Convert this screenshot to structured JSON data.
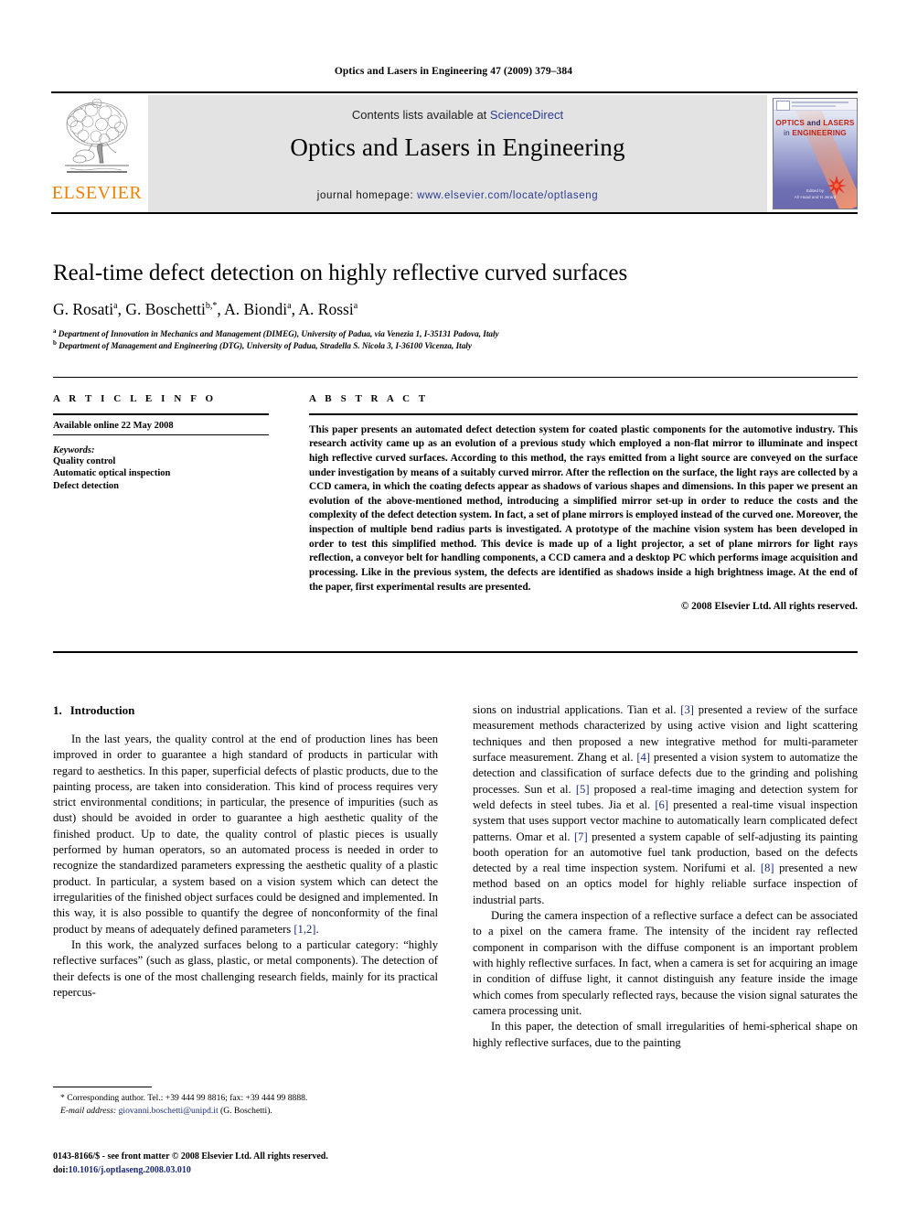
{
  "running_head": "Optics and Lasers in Engineering 47 (2009) 379–384",
  "masthead": {
    "publisher_name": "ELSEVIER",
    "contents_prefix": "Contents lists available at ",
    "contents_link": "ScienceDirect",
    "journal_name": "Optics and Lasers in Engineering",
    "homepage_prefix": "journal homepage: ",
    "homepage_url": "www.elsevier.com/locate/optlaseng",
    "cover": {
      "title_line1_main": "OPTICS",
      "title_line1_and": " and ",
      "title_line1_main2": "LASERS",
      "title_line2_in": "in ",
      "title_line2_main": "ENGINEERING",
      "caption": "Edited by\nAh Huad and H Jerard"
    }
  },
  "article": {
    "title": "Real-time defect detection on highly reflective curved surfaces",
    "authors_html": "G. Rosati a, G. Boschetti b,*, A. Biondi a, A. Rossi a",
    "authors": [
      {
        "name": "G. Rosati",
        "marks": "a"
      },
      {
        "name": "G. Boschetti",
        "marks": "b,*"
      },
      {
        "name": "A. Biondi",
        "marks": "a"
      },
      {
        "name": "A. Rossi",
        "marks": "a"
      }
    ],
    "affiliation_a": "Department of Innovation in Mechanics and Management (DIMEG), University of Padua, via Venezia 1, I-35131 Padova, Italy",
    "affiliation_b": "Department of Management and Engineering (DTG), University of Padua, Stradella S. Nicola 3, I-36100 Vicenza, Italy"
  },
  "article_info": {
    "heading": "A R T I C L E  I N F O",
    "history": "Available online 22 May 2008",
    "keywords_label": "Keywords:",
    "keywords": [
      "Quality control",
      "Automatic optical inspection",
      "Defect detection"
    ]
  },
  "abstract": {
    "heading": "A B S T R A C T",
    "text": "This paper presents an automated defect detection system for coated plastic components for the automotive industry. This research activity came up as an evolution of a previous study which employed a non-flat mirror to illuminate and inspect high reflective curved surfaces. According to this method, the rays emitted from a light source are conveyed on the surface under investigation by means of a suitably curved mirror. After the reflection on the surface, the light rays are collected by a CCD camera, in which the coating defects appear as shadows of various shapes and dimensions. In this paper we present an evolution of the above-mentioned method, introducing a simplified mirror set-up in order to reduce the costs and the complexity of the defect detection system. In fact, a set of plane mirrors is employed instead of the curved one. Moreover, the inspection of multiple bend radius parts is investigated. A prototype of the machine vision system has been developed in order to test this simplified method. This device is made up of a light projector, a set of plane mirrors for light rays reflection, a conveyor belt for handling components, a CCD camera and a desktop PC which performs image acquisition and processing. Like in the previous system, the defects are identified as shadows inside a high brightness image. At the end of the paper, first experimental results are presented.",
    "copyright": "© 2008 Elsevier Ltd. All rights reserved."
  },
  "body": {
    "section_number": "1.",
    "section_title": "Introduction",
    "left_paragraphs": [
      "In the last years, the quality control at the end of production lines has been improved in order to guarantee a high standard of products in particular with regard to aesthetics. In this paper, superficial defects of plastic products, due to the painting process, are taken into consideration. This kind of process requires very strict environmental conditions; in particular, the presence of impurities (such as dust) should be avoided in order to guarantee a high aesthetic quality of the finished product. Up to date, the quality control of plastic pieces is usually performed by human operators, so an automated process is needed in order to recognize the standardized parameters expressing the aesthetic quality of a plastic product. In particular, a system based on a vision system which can detect the irregularities of the finished object surfaces could be designed and implemented. In this way, it is also possible to quantify the degree of nonconformity of the final product by means of adequately defined parameters [1,2].",
      "In this work, the analyzed surfaces belong to a particular category: “highly reflective surfaces” (such as glass, plastic, or metal components). The detection of their defects is one of the most challenging research fields, mainly for its practical repercus-"
    ],
    "right_paragraphs": [
      "sions on industrial applications. Tian et al. [3] presented a review of the surface measurement methods characterized by using active vision and light scattering techniques and then proposed a new integrative method for multi-parameter surface measurement. Zhang et al. [4] presented a vision system to automatize the detection and classification of surface defects due to the grinding and polishing processes. Sun et al. [5] proposed a real-time imaging and detection system for weld defects in steel tubes. Jia et al. [6] presented a real-time visual inspection system that uses support vector machine to automatically learn complicated defect patterns. Omar et al. [7] presented a system capable of self-adjusting its painting booth operation for an automotive fuel tank production, based on the defects detected by a real time inspection system. Norifumi et al. [8] presented a new method based on an optics model for highly reliable surface inspection of industrial parts.",
      "During the camera inspection of a reflective surface a defect can be associated to a pixel on the camera frame. The intensity of the incident ray reflected component in comparison with the diffuse component is an important problem with highly reflective surfaces. In fact, when a camera is set for acquiring an image in condition of diffuse light, it cannot distinguish any feature inside the image which comes from specularly reflected rays, because the vision signal saturates the camera processing unit.",
      "In this paper, the detection of small irregularities of hemi-spherical shape on highly reflective surfaces, due to the painting"
    ],
    "references_marks": [
      "[1,2]",
      "[3]",
      "[4]",
      "[5]",
      "[6]",
      "[7]",
      "[8]"
    ]
  },
  "footnote": {
    "corresponding": "* Corresponding author. Tel.: +39 444 99 8816; fax: +39 444 99 8888.",
    "email_label": "E-mail address:",
    "email": " giovanni.boschetti@unipd.it",
    "email_owner": " (G. Boschetti)."
  },
  "imprint": {
    "front_matter": "0143-8166/$ - see front matter © 2008 Elsevier Ltd. All rights reserved.",
    "doi_label": "doi:",
    "doi_value": "10.1016/j.optlaseng.2008.03.010"
  },
  "colors": {
    "link_blue": "#2b3a8f",
    "ref_blue": "#1a2a7a",
    "elsevier_orange": "#F08000",
    "band_gray": "#e3e3e3"
  }
}
